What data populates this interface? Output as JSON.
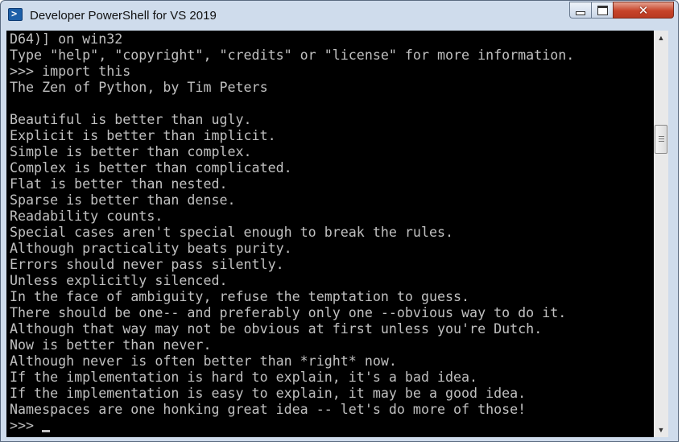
{
  "window": {
    "title": "Developer PowerShell for VS 2019",
    "app_icon": "powershell-icon",
    "controls": {
      "minimize": "minimize-icon",
      "maximize": "maximize-icon",
      "close": "close-icon"
    }
  },
  "console": {
    "lines": [
      "D64)] on win32",
      "Type \"help\", \"copyright\", \"credits\" or \"license\" for more information.",
      ">>> import this",
      "The Zen of Python, by Tim Peters",
      "",
      "Beautiful is better than ugly.",
      "Explicit is better than implicit.",
      "Simple is better than complex.",
      "Complex is better than complicated.",
      "Flat is better than nested.",
      "Sparse is better than dense.",
      "Readability counts.",
      "Special cases aren't special enough to break the rules.",
      "Although practicality beats purity.",
      "Errors should never pass silently.",
      "Unless explicitly silenced.",
      "In the face of ambiguity, refuse the temptation to guess.",
      "There should be one-- and preferably only one --obvious way to do it.",
      "Although that way may not be obvious at first unless you're Dutch.",
      "Now is better than never.",
      "Although never is often better than *right* now.",
      "If the implementation is hard to explain, it's a bad idea.",
      "If the implementation is easy to explain, it may be a good idea.",
      "Namespaces are one honking great idea -- let's do more of those!"
    ],
    "prompt": ">>>",
    "text_color": "#c0c0c0",
    "background": "#000000"
  },
  "scrollbar": {
    "up_icon": "scroll-up-arrow-icon",
    "down_icon": "scroll-down-arrow-icon",
    "position_fraction": 0.24
  }
}
